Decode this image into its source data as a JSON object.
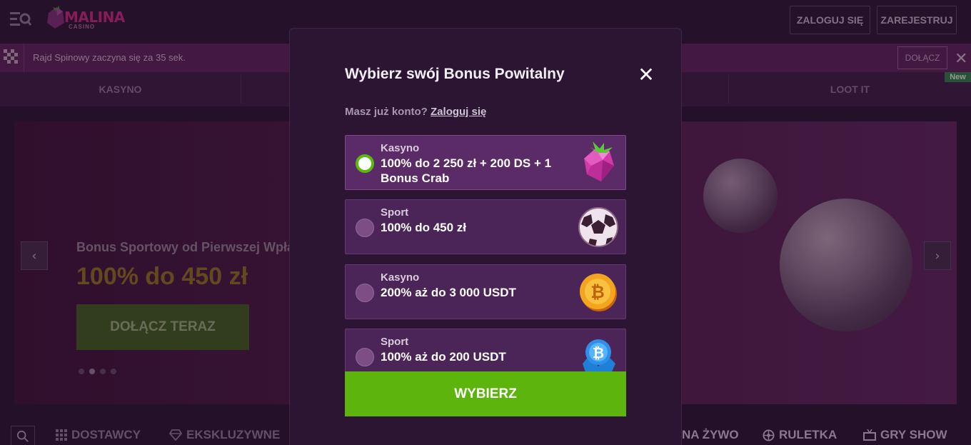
{
  "header": {
    "logo_name": "MALINA",
    "logo_sub": "CASINO",
    "login_label": "ZALOGUJ SIĘ",
    "register_label": "ZAREJESTRUJ"
  },
  "ticker": {
    "text": "Rajd Spinowy zaczyna się za 35 sek.",
    "join_label": "DOŁĄCZ"
  },
  "category_nav": {
    "tabs": [
      "KASYNO",
      "LOOT IT"
    ],
    "new_badge": "New"
  },
  "banner": {
    "subtitle": "Bonus Sportowy od Pierwszej Wpłaty",
    "amount": "100% do 450 zł",
    "cta_label": "DOŁĄCZ TERAZ"
  },
  "bottom_nav": {
    "items": [
      "DOSTAWCY",
      "EKSKLUZYWNE",
      "NA ŻYWO",
      "RULETKA",
      "GRY SHOW"
    ]
  },
  "modal": {
    "title": "Wybierz swój Bonus Powitalny",
    "account_prompt": "Masz już konto?",
    "login_link": "Zaloguj się",
    "options": [
      {
        "category": "Kasyno",
        "text": "100% do 2 250 zł + 200 DS + 1 Bonus Crab",
        "icon": "strawberry-gem-icon",
        "selected": true
      },
      {
        "category": "Sport",
        "text": "100% do 450 zł",
        "icon": "soccer-ball-icon",
        "selected": false
      },
      {
        "category": "Kasyno",
        "text": "200% aż do 3 000 USDT",
        "icon": "bitcoin-coin-icon",
        "selected": false
      },
      {
        "category": "Sport",
        "text": "100% aż do 200 USDT",
        "icon": "bitcoin-crystal-icon",
        "selected": false
      }
    ],
    "choose_label": "WYBIERZ"
  },
  "colors": {
    "background": "#2a1530",
    "modal_bg": "#2b1533",
    "option_bg": "#4b2557",
    "accent_green": "#5cb40c",
    "brand_pink": "#c0287d"
  }
}
